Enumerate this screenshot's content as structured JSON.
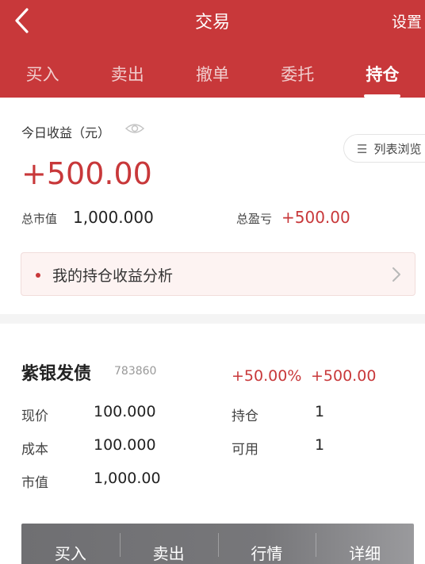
{
  "header": {
    "title": "交易",
    "settings_label": "设置",
    "back_icon": "chevron-left-icon",
    "bg_color": "#c8383a"
  },
  "tabs": [
    {
      "label": "买入",
      "active": false
    },
    {
      "label": "卖出",
      "active": false
    },
    {
      "label": "撤单",
      "active": false
    },
    {
      "label": "委托",
      "active": false
    },
    {
      "label": "持仓",
      "active": true
    }
  ],
  "summary": {
    "today_label": "今日收益（元）",
    "eye_icon": "eye-icon",
    "list_toggle_label": "列表浏览",
    "list_icon": "list-icon",
    "today_profit": "+500.00",
    "market_value_label": "总市值",
    "market_value": "1,000.000",
    "total_pl_label": "总盈亏",
    "total_pl": "+500.00",
    "analysis_label": "我的持仓收益分析"
  },
  "position": {
    "name": "紫银发债",
    "code": "783860",
    "pct": "+50.00%",
    "amount": "+500.00",
    "fields": {
      "price_label": "现价",
      "price": "100.000",
      "cost_label": "成本",
      "cost": "100.000",
      "mv_label": "市值",
      "mv": "1,000.00",
      "hold_label": "持仓",
      "hold": "1",
      "avail_label": "可用",
      "avail": "1"
    },
    "actions": [
      "买入",
      "卖出",
      "行情",
      "详细"
    ]
  },
  "colors": {
    "accent": "#c8383a"
  }
}
